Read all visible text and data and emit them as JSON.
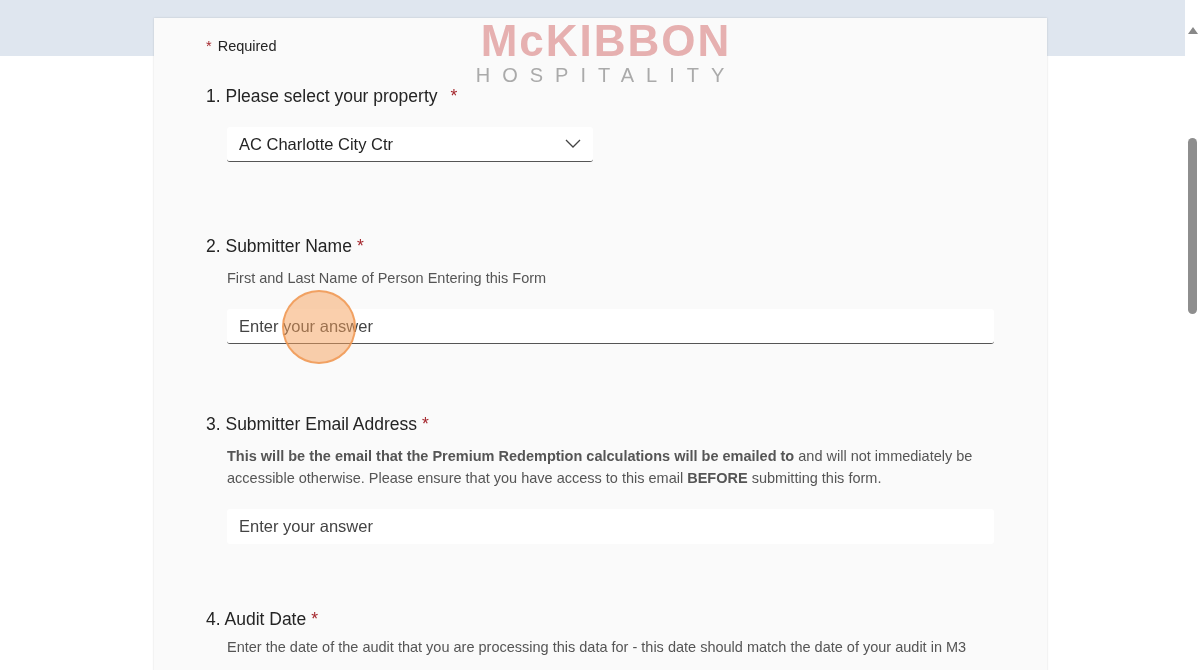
{
  "logo": {
    "name": "McKIBBON",
    "tagline": "HOSPITALITY"
  },
  "required_note": {
    "mark": "*",
    "label": "Required"
  },
  "questions": [
    {
      "number": "1.",
      "title": "Please select your property",
      "required": true,
      "kind": "dropdown",
      "value": "AC Charlotte City Ctr"
    },
    {
      "number": "2.",
      "title": "Submitter Name",
      "required": true,
      "kind": "text",
      "subtitle": "First and Last Name of Person Entering this Form",
      "placeholder": "Enter your answer",
      "focused": true
    },
    {
      "number": "3.",
      "title": "Submitter Email Address",
      "required": true,
      "kind": "text",
      "subtitle": "**This will be the email that the Premium Redemption calculations will be emailed to** and will not immediately be accessible otherwise. Please ensure that you have access to this email **BEFORE** submitting this form.",
      "placeholder": "Enter your answer",
      "focused": false
    },
    {
      "number": "4.",
      "title": "Audit Date",
      "required": true,
      "kind": "none",
      "subtitle": "Enter the date of the audit that you are processing this data for - this date should match the date of your audit in M3"
    }
  ]
}
